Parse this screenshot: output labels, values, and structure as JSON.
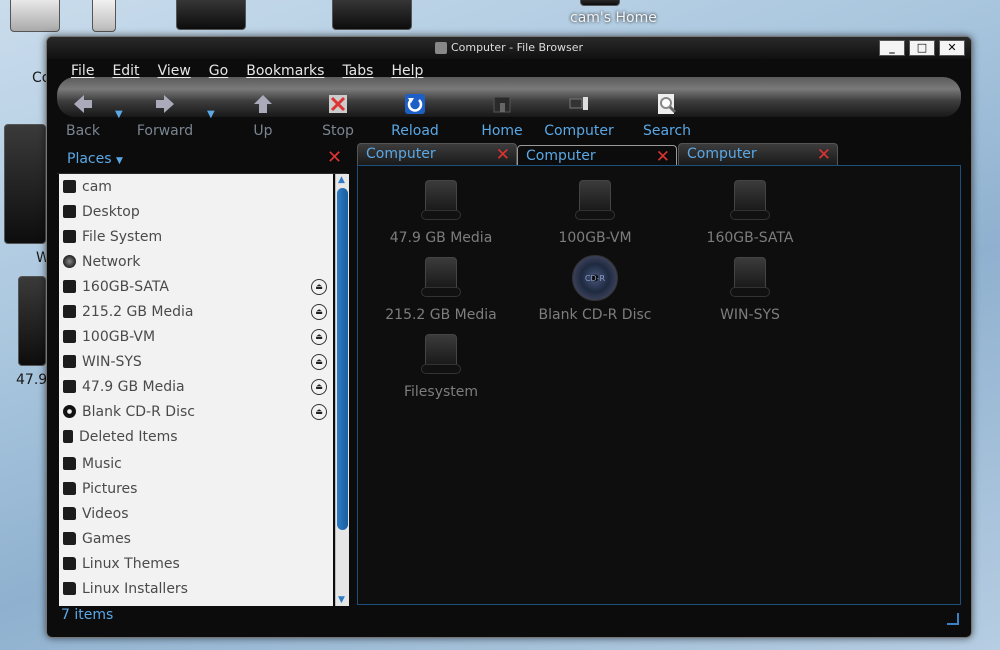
{
  "desktop": {
    "home_label": "cam's Home",
    "partial_labels": [
      "Co",
      "W",
      "47.9"
    ]
  },
  "window": {
    "title": "Computer - File Browser",
    "buttons": [
      "_",
      "□",
      "✕"
    ]
  },
  "menu": [
    "File",
    "Edit",
    "View",
    "Go",
    "Bookmarks",
    "Tabs",
    "Help"
  ],
  "toolbar": {
    "back": "Back",
    "forward": "Forward",
    "up": "Up",
    "stop": "Stop",
    "reload": "Reload",
    "home": "Home",
    "computer": "Computer",
    "search": "Search"
  },
  "sidebar": {
    "header": "Places",
    "items": [
      {
        "label": "cam",
        "icon": "home-folder-icon"
      },
      {
        "label": "Desktop",
        "icon": "desktop-icon"
      },
      {
        "label": "File System",
        "icon": "drive-icon"
      },
      {
        "label": "Network",
        "icon": "network-icon"
      },
      {
        "label": "160GB-SATA",
        "icon": "drive-icon",
        "eject": true
      },
      {
        "label": "215.2 GB Media",
        "icon": "drive-icon",
        "eject": true
      },
      {
        "label": "100GB-VM",
        "icon": "drive-icon",
        "eject": true
      },
      {
        "label": "WIN-SYS",
        "icon": "drive-icon",
        "eject": true
      },
      {
        "label": "47.9 GB Media",
        "icon": "drive-icon",
        "eject": true
      },
      {
        "label": "Blank CD-R Disc",
        "icon": "disc-icon",
        "eject": true
      },
      {
        "label": "Deleted Items",
        "icon": "trash-icon"
      },
      {
        "label": "Music",
        "icon": "folder-icon"
      },
      {
        "label": "Pictures",
        "icon": "folder-icon"
      },
      {
        "label": "Videos",
        "icon": "folder-icon"
      },
      {
        "label": "Games",
        "icon": "folder-icon"
      },
      {
        "label": "Linux Themes",
        "icon": "folder-icon"
      },
      {
        "label": "Linux Installers",
        "icon": "folder-icon"
      }
    ]
  },
  "tabs": [
    {
      "label": "Computer"
    },
    {
      "label": "Computer"
    },
    {
      "label": "Computer"
    }
  ],
  "files": [
    {
      "label": "47.9 GB Media",
      "type": "drive"
    },
    {
      "label": "100GB-VM",
      "type": "drive"
    },
    {
      "label": "160GB-SATA",
      "type": "drive"
    },
    {
      "label": "215.2 GB Media",
      "type": "drive"
    },
    {
      "label": "Blank CD-R Disc",
      "type": "cd",
      "disc_text": "CD-R"
    },
    {
      "label": "WIN-SYS",
      "type": "drive"
    },
    {
      "label": "Filesystem",
      "type": "drive"
    }
  ],
  "status": "7 items",
  "colors": {
    "accent": "#5aa8e6",
    "close_red": "#d33333",
    "window_bg": "#0c0c0c"
  }
}
